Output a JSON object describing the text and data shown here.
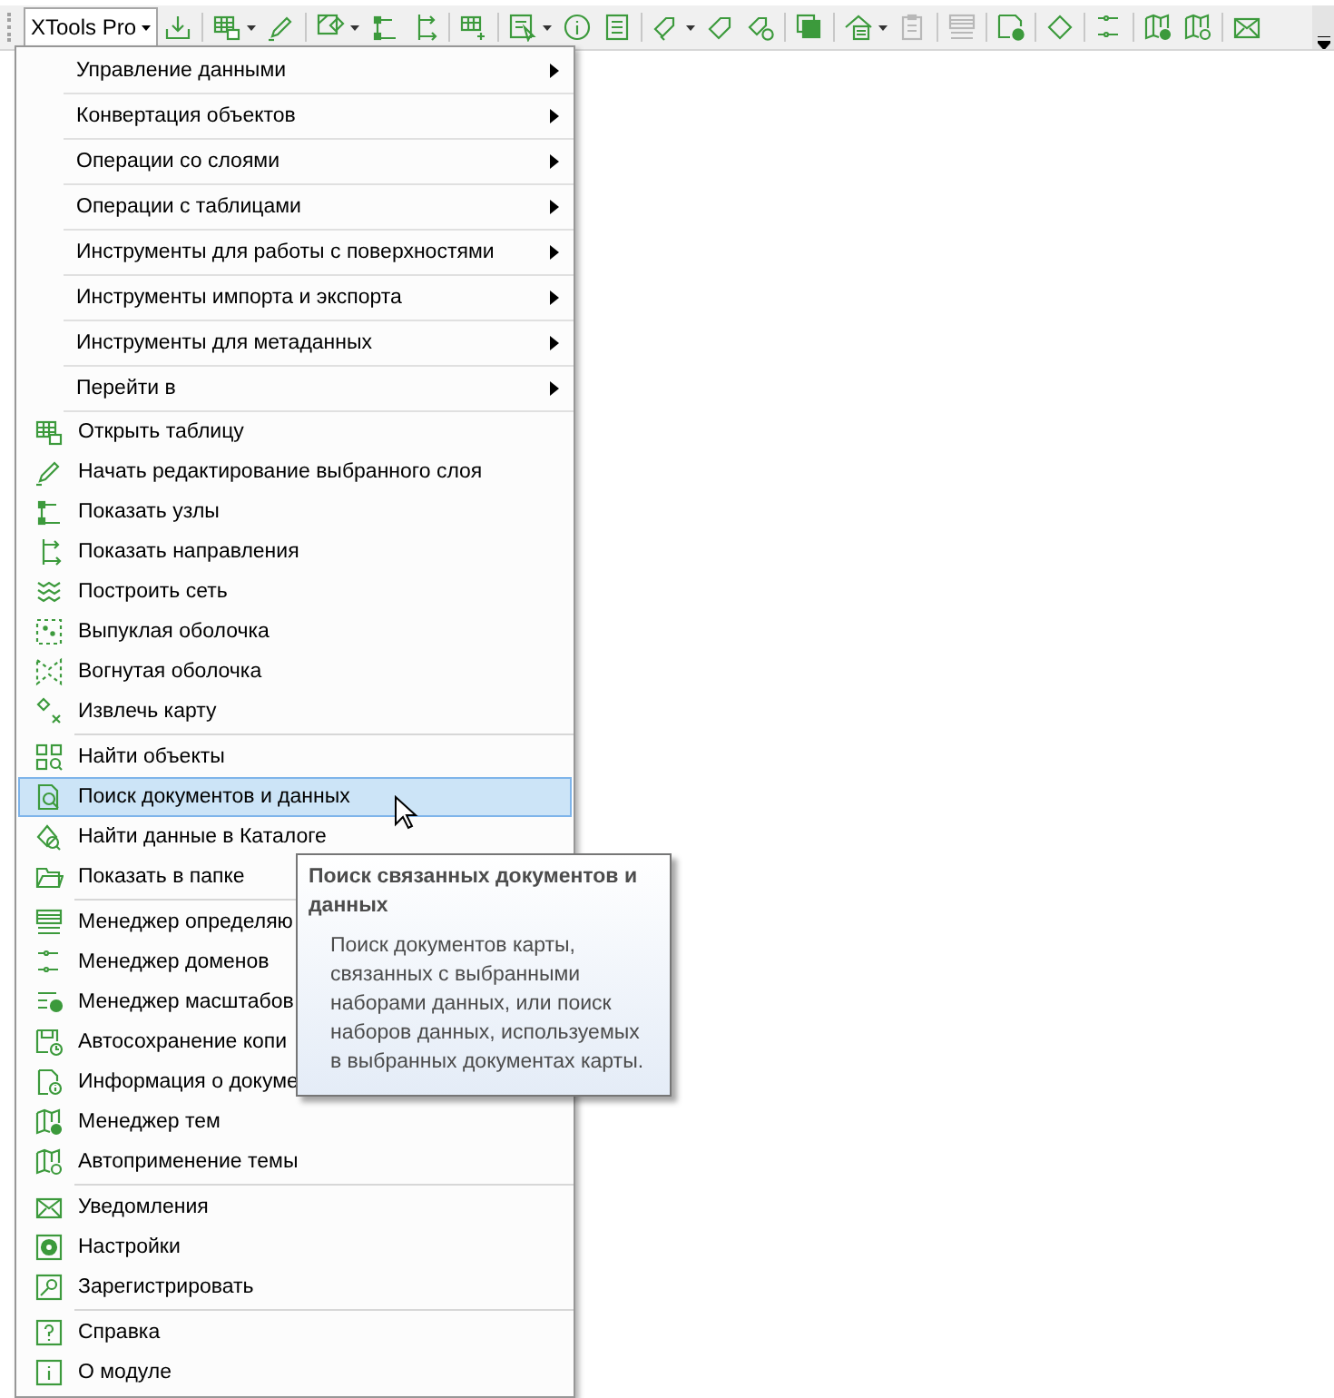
{
  "toolbar": {
    "title": "XTools Pro",
    "items": [
      {
        "kind": "button",
        "dropdown": false,
        "disabled": false
      },
      {
        "kind": "separator"
      },
      {
        "kind": "button",
        "dropdown": true,
        "disabled": false
      },
      {
        "kind": "button",
        "dropdown": false,
        "disabled": false
      },
      {
        "kind": "separator"
      },
      {
        "kind": "button",
        "dropdown": true,
        "disabled": false
      },
      {
        "kind": "button",
        "dropdown": false,
        "disabled": false
      },
      {
        "kind": "button",
        "dropdown": false,
        "disabled": false
      },
      {
        "kind": "separator"
      },
      {
        "kind": "button",
        "dropdown": false,
        "disabled": false
      },
      {
        "kind": "separator"
      },
      {
        "kind": "button",
        "dropdown": true,
        "disabled": false
      },
      {
        "kind": "button",
        "dropdown": false,
        "disabled": false
      },
      {
        "kind": "button",
        "dropdown": false,
        "disabled": false
      },
      {
        "kind": "separator"
      },
      {
        "kind": "button",
        "dropdown": true,
        "disabled": false
      },
      {
        "kind": "button",
        "dropdown": false,
        "disabled": false
      },
      {
        "kind": "button",
        "dropdown": false,
        "disabled": false
      },
      {
        "kind": "separator"
      },
      {
        "kind": "button",
        "dropdown": false,
        "disabled": false
      },
      {
        "kind": "separator"
      },
      {
        "kind": "button",
        "dropdown": true,
        "disabled": false
      },
      {
        "kind": "button",
        "dropdown": false,
        "disabled": true
      },
      {
        "kind": "separator"
      },
      {
        "kind": "button",
        "dropdown": false,
        "disabled": true
      },
      {
        "kind": "separator"
      },
      {
        "kind": "button",
        "dropdown": false,
        "disabled": false
      },
      {
        "kind": "separator"
      },
      {
        "kind": "button",
        "dropdown": false,
        "disabled": false
      },
      {
        "kind": "separator"
      },
      {
        "kind": "button",
        "dropdown": false,
        "disabled": false
      },
      {
        "kind": "separator"
      },
      {
        "kind": "button",
        "dropdown": false,
        "disabled": false
      },
      {
        "kind": "button",
        "dropdown": false,
        "disabled": false
      },
      {
        "kind": "separator"
      },
      {
        "kind": "button",
        "dropdown": false,
        "disabled": false
      }
    ]
  },
  "menu": {
    "sections": [
      {
        "kind": "submenus",
        "items": [
          {
            "label": "Управление данными",
            "selected": false
          },
          {
            "label": "Конвертация объектов",
            "selected": false
          },
          {
            "label": "Операции со слоями",
            "selected": false
          },
          {
            "label": "Операции с таблицами",
            "selected": false
          },
          {
            "label": "Инструменты для работы с поверхностями",
            "selected": false
          },
          {
            "label": "Инструменты импорта и экспорта",
            "selected": false
          },
          {
            "label": "Инструменты для метаданных",
            "selected": false
          },
          {
            "label": "Перейти в",
            "selected": false
          }
        ]
      },
      {
        "kind": "commands",
        "items": [
          {
            "label": "Открыть таблицу",
            "selected": false
          },
          {
            "label": "Начать редактирование выбранного слоя",
            "selected": false
          },
          {
            "label": "Показать узлы",
            "selected": false
          },
          {
            "label": "Показать направления",
            "selected": false
          },
          {
            "label": "Построить сеть",
            "selected": false
          },
          {
            "label": "Выпуклая оболочка",
            "selected": false
          },
          {
            "label": "Вогнутая оболочка",
            "selected": false
          },
          {
            "label": "Извлечь карту",
            "selected": false
          }
        ]
      },
      {
        "kind": "commands",
        "items": [
          {
            "label": "Найти объекты",
            "selected": false
          },
          {
            "label": "Поиск документов и данных",
            "selected": true
          },
          {
            "label": "Найти данные в Каталоге",
            "selected": false
          },
          {
            "label": "Показать в папке",
            "selected": false
          }
        ]
      },
      {
        "kind": "commands",
        "items": [
          {
            "label": "Менеджер определяю",
            "selected": false
          },
          {
            "label": "Менеджер доменов",
            "selected": false
          },
          {
            "label": "Менеджер масштабов",
            "selected": false
          },
          {
            "label": "Автосохранение копи",
            "selected": false
          },
          {
            "label": "Информация о докуме",
            "selected": false
          },
          {
            "label": "Менеджер тем",
            "selected": false
          },
          {
            "label": "Автоприменение темы",
            "selected": false
          }
        ]
      },
      {
        "kind": "commands",
        "items": [
          {
            "label": "Уведомления",
            "selected": false
          },
          {
            "label": "Настройки",
            "selected": false
          },
          {
            "label": "Зарегистрировать",
            "selected": false
          }
        ]
      },
      {
        "kind": "commands",
        "items": [
          {
            "label": "Справка",
            "selected": false
          },
          {
            "label": "О модуле",
            "selected": false
          }
        ]
      }
    ]
  },
  "tooltip": {
    "title": "Поиск связанных документов и данных",
    "text": "Поиск документов карты, связанных с выбранными наборами данных, или поиск наборов данных, используемых в выбранных документах карты."
  }
}
